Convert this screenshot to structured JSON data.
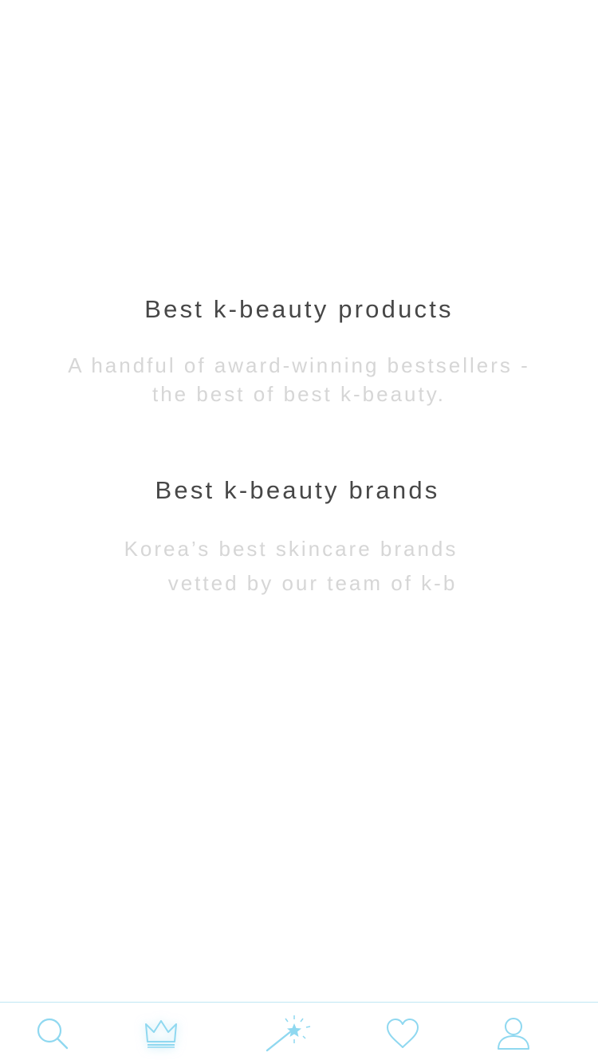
{
  "sections": [
    {
      "title": "Best k-beauty products",
      "subtitle_lines": [
        "A handful of award-winning bestsellers -",
        "the best of best k-beauty."
      ]
    },
    {
      "title": "Best k-beauty brands",
      "subtitle_lines": [
        "Korea’s best skincare brands",
        "vetted by our team of k-b"
      ]
    }
  ],
  "tabbar": {
    "accent_color": "#8fd8f0",
    "border_color": "#bfe8f4",
    "active_tab": "crown",
    "tabs": [
      {
        "id": "search",
        "icon": "search-icon"
      },
      {
        "id": "crown",
        "icon": "crown-icon"
      },
      {
        "id": "magic",
        "icon": "magic-wand-icon"
      },
      {
        "id": "favorites",
        "icon": "heart-icon"
      },
      {
        "id": "profile",
        "icon": "user-icon"
      }
    ]
  }
}
